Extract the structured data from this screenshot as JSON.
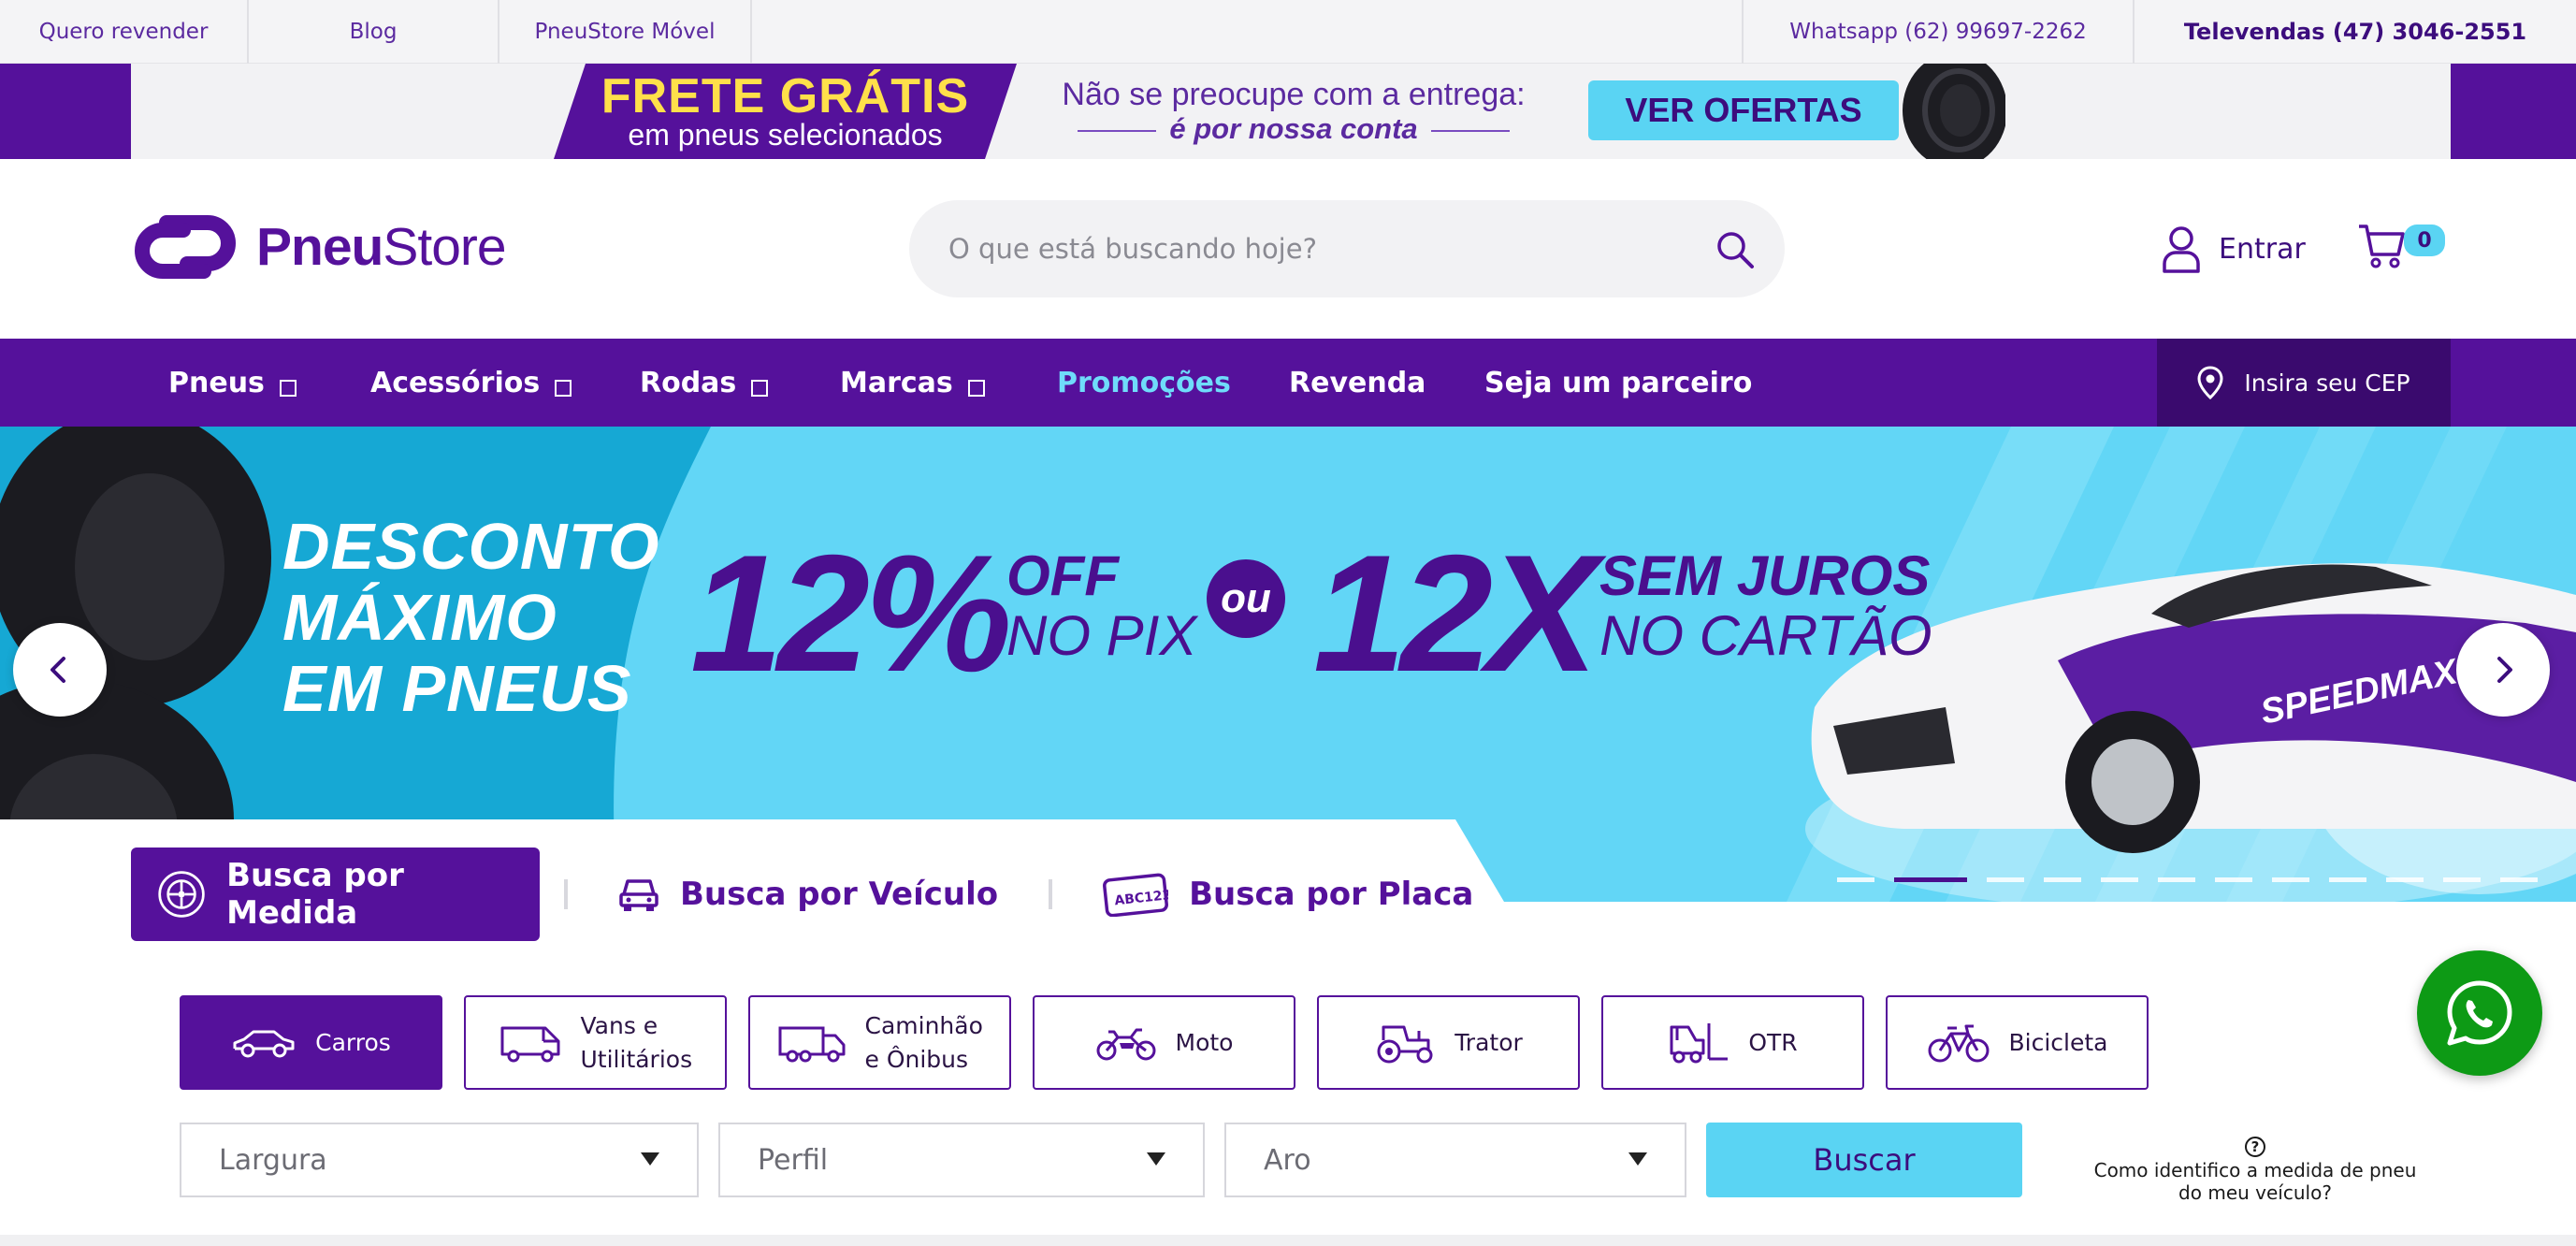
{
  "topbar": {
    "links_left": [
      "Quero revender",
      "Blog",
      "PneuStore Móvel"
    ],
    "whatsapp": "Whatsapp (62) 99697-2262",
    "televendas": "Televendas (47) 3046-2551"
  },
  "promo": {
    "frete_title": "FRETE GRÁTIS",
    "frete_sub": "em pneus selecionados",
    "msg_line1": "Não se preocupe com a entrega:",
    "msg_line2": "é por nossa conta",
    "cta": "VER OFERTAS"
  },
  "header": {
    "logo_bold": "Pneu",
    "logo_light": "Store",
    "search_placeholder": "O que está buscando hoje?",
    "login_label": "Entrar",
    "cart_count": "0"
  },
  "nav": {
    "items": [
      {
        "label": "Pneus",
        "dropdown": true
      },
      {
        "label": "Acessórios",
        "dropdown": true
      },
      {
        "label": "Rodas",
        "dropdown": true
      },
      {
        "label": "Marcas",
        "dropdown": true
      },
      {
        "label": "Promoções",
        "dropdown": false
      },
      {
        "label": "Revenda",
        "dropdown": false
      },
      {
        "label": "Seja um parceiro",
        "dropdown": false
      }
    ],
    "cep_label": "Insira seu CEP"
  },
  "hero": {
    "headline": [
      "DESCONTO",
      "MÁXIMO",
      "EM PNEUS"
    ],
    "pct": "12%",
    "pct_sub1": "OFF",
    "pct_sub2": "NO PIX",
    "ou": "ou",
    "installments": "12X",
    "inst_sub1": "SEM JUROS",
    "inst_sub2": "NO CARTÃO",
    "car_brand": "SPEEDMAX",
    "slide_count": 12,
    "active_slide": 2
  },
  "search_tabs": [
    "Busca por Medida",
    "Busca por Veículo",
    "Busca por Placa"
  ],
  "plate_text": "ABC123",
  "vehicle_types": [
    "Carros",
    "Vans e Utilitários",
    "Caminhão e Ônibus",
    "Moto",
    "Trator",
    "OTR",
    "Bicicleta"
  ],
  "selects": {
    "largura": "Largura",
    "perfil": "Perfil",
    "aro": "Aro"
  },
  "buscar_label": "Buscar",
  "help_text": "Como identifico a medida de pneu do meu veículo?",
  "colors": {
    "primary": "#55119b",
    "accent": "#5ad4f3",
    "promo_yellow": "#ffe04a",
    "whatsapp_green": "#0d9a15"
  }
}
